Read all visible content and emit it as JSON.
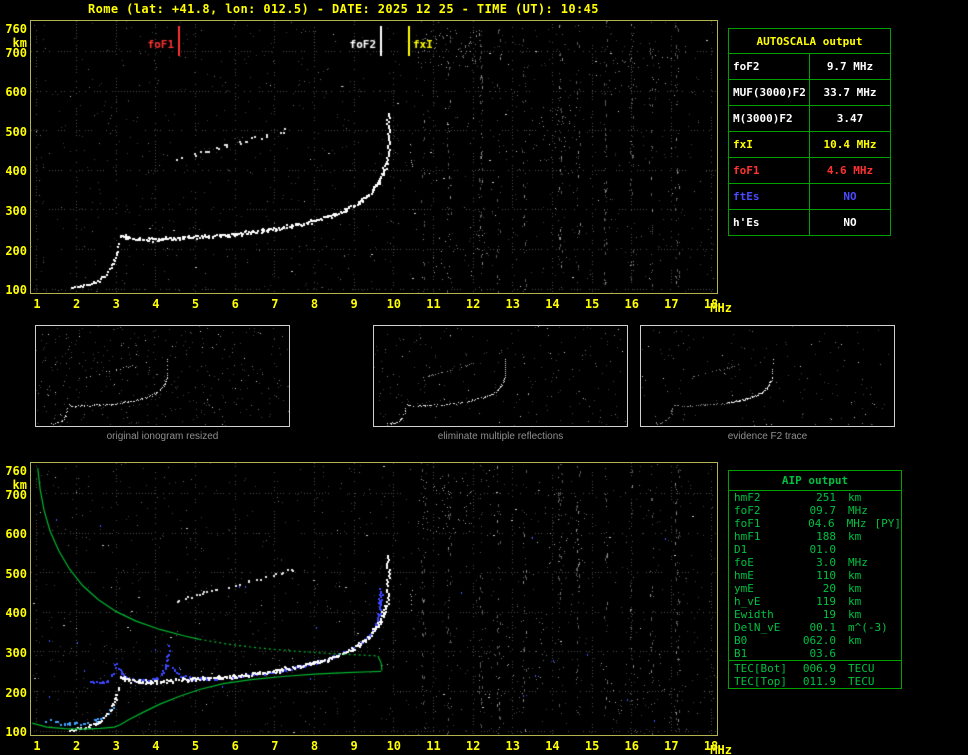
{
  "title": "Rome (lat: +41.8, lon: 012.5) - DATE: 2025 12 25 - TIME (UT): 10:45",
  "autoscala_table": {
    "header": "AUTOSCALA output",
    "rows": [
      {
        "label": "foF2",
        "value": "9.7 MHz",
        "color": "#ffffff"
      },
      {
        "label": "MUF(3000)F2",
        "value": "33.7 MHz",
        "color": "#ffffff"
      },
      {
        "label": "M(3000)F2",
        "value": "3.47",
        "color": "#ffffff"
      },
      {
        "label": "fxI",
        "value": "10.4 MHz",
        "color": "#ffff00"
      },
      {
        "label": "foF1",
        "value": "4.6 MHz",
        "color": "#ff3232"
      },
      {
        "label": "ftEs",
        "value": "NO",
        "color": "#4a4aff"
      },
      {
        "label": "h'Es",
        "value": "NO",
        "color": "#ffffff"
      }
    ]
  },
  "aip_table": {
    "header": "AIP output",
    "rows": [
      {
        "label": "hmF2",
        "value": "251",
        "unit": "km",
        "extra": ""
      },
      {
        "label": "foF2",
        "value": "09.7",
        "unit": "MHz",
        "extra": ""
      },
      {
        "label": "foF1",
        "value": "04.6",
        "unit": "MHz",
        "extra": "[PY]"
      },
      {
        "label": "hmF1",
        "value": "188",
        "unit": "km",
        "extra": ""
      },
      {
        "label": "D1",
        "value": "01.0",
        "unit": "",
        "extra": ""
      },
      {
        "label": "foE",
        "value": "3.0",
        "unit": "MHz",
        "extra": ""
      },
      {
        "label": "hmE",
        "value": "110",
        "unit": "km",
        "extra": ""
      },
      {
        "label": "ymE",
        "value": "20",
        "unit": "km",
        "extra": ""
      },
      {
        "label": "h_vE",
        "value": "119",
        "unit": "km",
        "extra": ""
      },
      {
        "label": "Ewidth",
        "value": "19",
        "unit": "km",
        "extra": ""
      },
      {
        "label": "DelN_vE",
        "value": "00.1",
        "unit": "m^(-3)",
        "extra": ""
      },
      {
        "label": "B0",
        "value": "062.0",
        "unit": "km",
        "extra": ""
      },
      {
        "label": "B1",
        "value": "03.6",
        "unit": "",
        "extra": ""
      }
    ],
    "tec_rows": [
      {
        "label": "TEC[Bot]",
        "value": "006.9",
        "unit": "TECU"
      },
      {
        "label": "TEC[Top]",
        "value": "011.9",
        "unit": "TECU"
      }
    ]
  },
  "thumbnails": [
    {
      "caption": "original ionogram resized"
    },
    {
      "caption": "eliminate multiple reflections"
    },
    {
      "caption": "evidence F2 trace"
    }
  ],
  "chart_data": {
    "type": "scatter",
    "title": "Ionogram - Rome (lat +41.8, lon 012.5), 2025-12-25 10:45 UT",
    "xlabel": "MHz",
    "ylabel": "km",
    "x_ticks": [
      1,
      2,
      3,
      4,
      5,
      6,
      7,
      8,
      9,
      10,
      11,
      12,
      13,
      14,
      15,
      16,
      17,
      18
    ],
    "y_ticks": [
      760,
      700,
      600,
      500,
      400,
      300,
      200,
      100
    ],
    "x_range": [
      0.85,
      18.15
    ],
    "y_range": [
      90,
      778
    ],
    "scaled_values": {
      "foF2_mhz": 9.7,
      "MUF3000F2_mhz": 33.7,
      "M3000F2": 3.47,
      "fxI_mhz": 10.4,
      "foF1_mhz": 4.6,
      "ftEs": "NO",
      "hEs": "NO"
    },
    "markers": [
      {
        "label": "foF1",
        "f_mhz": 4.6,
        "color": "#ff3232",
        "label_side": "left"
      },
      {
        "label": "foF2",
        "f_mhz": 9.7,
        "color": "#ffffff",
        "label_side": "left"
      },
      {
        "label": "fxI",
        "f_mhz": 10.4,
        "color": "#ffff00",
        "label_side": "right"
      }
    ],
    "interference_bands_mhz": [
      10.75,
      11.4,
      12.2,
      12.65,
      13.3,
      14.2,
      14.65,
      15.35,
      16.0,
      16.5,
      17.15
    ],
    "trace_e": [
      [
        1.85,
        103
      ],
      [
        2.05,
        106
      ],
      [
        2.3,
        112
      ],
      [
        2.55,
        122
      ],
      [
        2.75,
        138
      ],
      [
        2.9,
        158
      ],
      [
        2.98,
        185
      ],
      [
        3.03,
        212
      ]
    ],
    "trace_f": [
      [
        3.1,
        236
      ],
      [
        3.3,
        229
      ],
      [
        3.6,
        226
      ],
      [
        4.0,
        226
      ],
      [
        4.4,
        228
      ],
      [
        4.8,
        231
      ],
      [
        5.2,
        233
      ],
      [
        5.6,
        235
      ],
      [
        6.0,
        238
      ],
      [
        6.4,
        243
      ],
      [
        6.8,
        249
      ],
      [
        7.2,
        256
      ],
      [
        7.6,
        264
      ],
      [
        8.0,
        273
      ],
      [
        8.4,
        285
      ],
      [
        8.8,
        301
      ],
      [
        9.1,
        317
      ],
      [
        9.35,
        336
      ],
      [
        9.5,
        355
      ],
      [
        9.62,
        372
      ],
      [
        9.72,
        392
      ],
      [
        9.8,
        415
      ]
    ],
    "trace_arc": [
      [
        4.3,
        420
      ],
      [
        4.8,
        438
      ],
      [
        5.3,
        452
      ],
      [
        5.8,
        464
      ],
      [
        6.3,
        476
      ],
      [
        6.8,
        489
      ],
      [
        7.2,
        500
      ],
      [
        7.45,
        507
      ]
    ],
    "asymptote_o": {
      "f_mhz": 9.85,
      "h_km": [
        415,
        545
      ]
    },
    "asymptote_x": {
      "f_mhz": 10.45,
      "h_km": [
        400,
        470
      ]
    },
    "fit_trace": {
      "fit_e": [
        [
          2.35,
          226
        ],
        [
          2.6,
          224
        ],
        [
          2.78,
          228
        ],
        [
          2.9,
          242
        ],
        [
          2.98,
          270
        ]
      ],
      "fit_f1": [
        [
          3.06,
          258
        ],
        [
          3.2,
          238
        ],
        [
          3.5,
          228
        ],
        [
          3.85,
          228
        ],
        [
          4.1,
          238
        ],
        [
          4.25,
          262
        ],
        [
          4.33,
          320
        ]
      ],
      "fit_f2": [
        [
          4.42,
          258
        ],
        [
          4.62,
          240
        ],
        [
          4.95,
          233
        ],
        [
          5.35,
          232
        ],
        [
          5.8,
          234
        ],
        [
          6.25,
          240
        ],
        [
          6.7,
          246
        ],
        [
          7.15,
          254
        ],
        [
          7.6,
          263
        ],
        [
          8.05,
          274
        ],
        [
          8.5,
          289
        ],
        [
          8.9,
          306
        ],
        [
          9.2,
          325
        ],
        [
          9.4,
          345
        ],
        [
          9.55,
          368
        ],
        [
          9.63,
          395
        ],
        [
          9.67,
          425
        ],
        [
          9.69,
          455
        ]
      ]
    },
    "e_trace_cyan": [
      [
        1.2,
        128
      ],
      [
        1.5,
        122
      ],
      [
        1.85,
        118
      ],
      [
        2.2,
        120
      ],
      [
        2.5,
        127
      ],
      [
        2.75,
        140
      ],
      [
        2.9,
        158
      ]
    ],
    "profile": {
      "color": "#00b830",
      "topside": [
        [
          1.02,
          765
        ],
        [
          1.08,
          712
        ],
        [
          1.18,
          658
        ],
        [
          1.33,
          606
        ],
        [
          1.55,
          556
        ],
        [
          1.82,
          510
        ],
        [
          2.15,
          468
        ],
        [
          2.55,
          432
        ],
        [
          3.0,
          402
        ],
        [
          3.5,
          378
        ],
        [
          4.1,
          357
        ],
        [
          4.7,
          341
        ],
        [
          5.1,
          332
        ]
      ],
      "topside_dotted": [
        [
          5.1,
          332
        ],
        [
          5.8,
          320
        ],
        [
          6.6,
          310
        ],
        [
          7.5,
          302
        ],
        [
          8.4,
          296
        ],
        [
          9.2,
          292
        ],
        [
          9.6,
          290
        ]
      ],
      "peak": [
        [
          9.6,
          290
        ],
        [
          9.68,
          272
        ],
        [
          9.7,
          253
        ]
      ],
      "bottomside": [
        [
          0.88,
          120
        ],
        [
          1.25,
          110
        ],
        [
          1.7,
          106
        ],
        [
          2.2,
          105
        ],
        [
          2.6,
          107
        ],
        [
          2.95,
          110
        ],
        [
          3.1,
          116
        ],
        [
          3.3,
          128
        ],
        [
          3.65,
          146
        ],
        [
          4.1,
          168
        ],
        [
          4.6,
          188
        ],
        [
          5.1,
          205
        ],
        [
          5.7,
          220
        ],
        [
          6.4,
          230
        ],
        [
          7.2,
          238
        ],
        [
          8.0,
          244
        ],
        [
          8.8,
          248
        ],
        [
          9.4,
          250
        ],
        [
          9.68,
          251
        ]
      ]
    }
  }
}
